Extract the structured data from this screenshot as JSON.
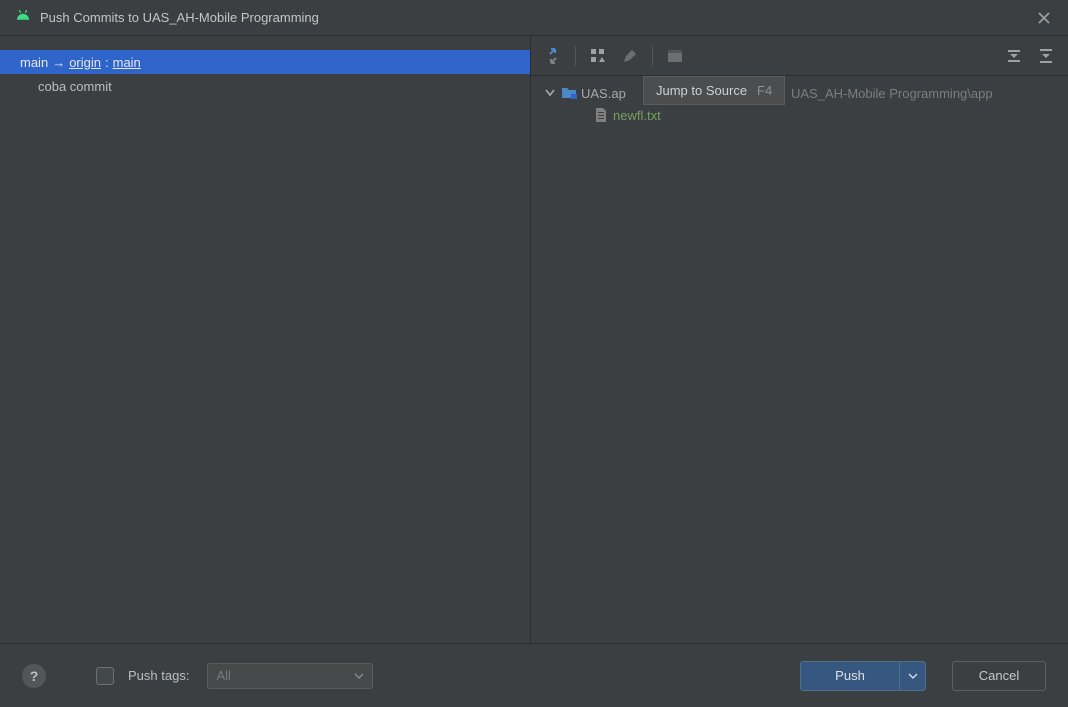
{
  "titlebar": {
    "title": "Push Commits to UAS_AH-Mobile Programming"
  },
  "left": {
    "branch": {
      "local": "main",
      "arrow": " → ",
      "remote": "origin",
      "colon": " : ",
      "remote_branch": "main"
    },
    "commits": [
      {
        "message": "coba commit"
      }
    ]
  },
  "right": {
    "tree": {
      "root_name_prefix": "UAS.ap",
      "root_path_suffix": "UAS_AH-Mobile Programming\\app",
      "files": [
        {
          "name": "newfl.txt"
        }
      ]
    }
  },
  "tooltip": {
    "label": "Jump to Source",
    "shortcut": "F4"
  },
  "footer": {
    "help": "?",
    "push_tags_label": "Push tags:",
    "select_value": "All",
    "push_button": "Push",
    "cancel_button": "Cancel"
  }
}
